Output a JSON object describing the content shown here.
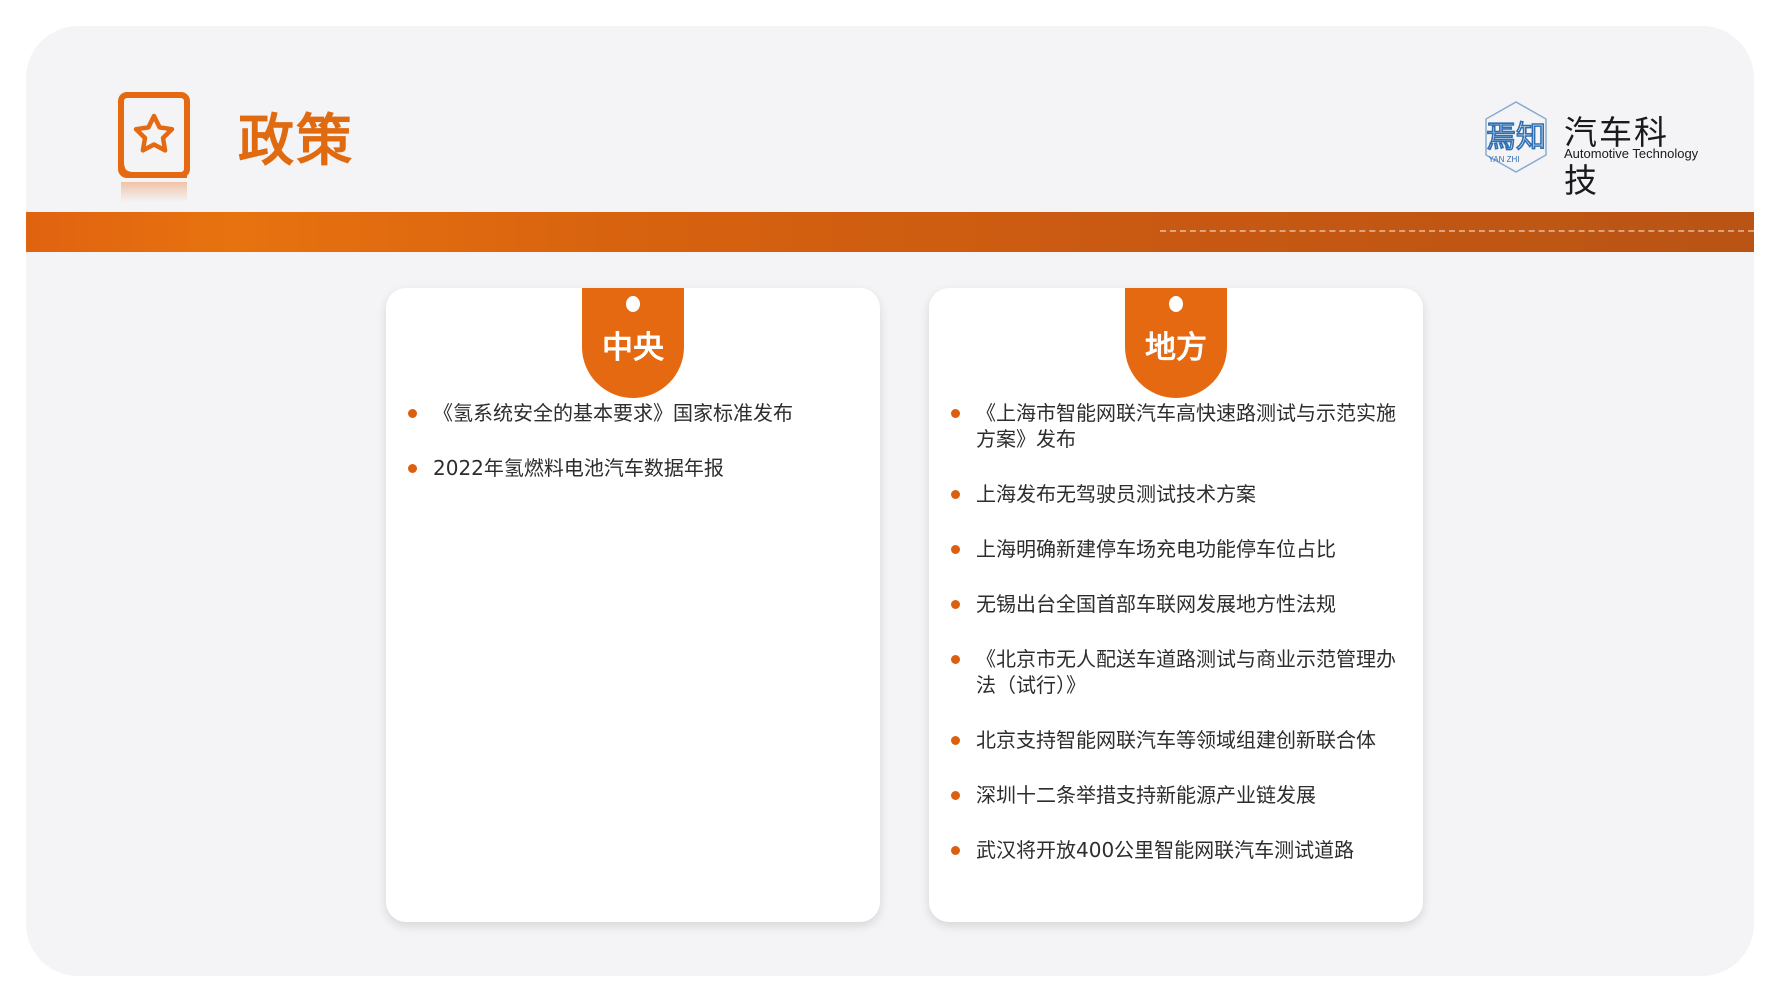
{
  "header": {
    "title": "政策",
    "logo": {
      "name_cn": "汽车科技",
      "name_en": "Automotive Technology",
      "mark_text": "焉知",
      "mark_subtext": "YAN ZHI"
    }
  },
  "colors": {
    "accent": "#e56910",
    "bar_start": "#e06310",
    "bar_end": "#b95414",
    "bullet": "#dc5f0e",
    "logo_blue": "#2f6fb2"
  },
  "central": {
    "tab_label": "中央",
    "items": [
      "《氢系统安全的基本要求》国家标准发布",
      "2022年氢燃料电池汽车数据年报"
    ]
  },
  "local": {
    "tab_label": "地方",
    "items": [
      "《上海市智能网联汽车高快速路测试与示范实施方案》发布",
      "上海发布无驾驶员测试技术方案",
      "上海明确新建停车场充电功能停车位占比",
      "无锡出台全国首部车联网发展地方性法规",
      "《北京市无人配送车道路测试与商业示范管理办法（试行）》",
      "北京支持智能网联汽车等领域组建创新联合体",
      "深圳十二条举措支持新能源产业链发展",
      "武汉将开放400公里智能网联汽车测试道路"
    ]
  },
  "icons": {
    "title_icon": "star-book-icon",
    "tab_icon": "tab-hole-icon",
    "bullet": "bullet-dot-icon"
  }
}
